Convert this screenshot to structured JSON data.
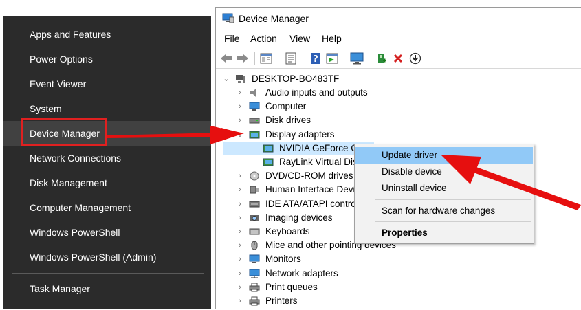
{
  "winx_menu": {
    "items": [
      {
        "label": "Apps and Features"
      },
      {
        "label": "Power Options"
      },
      {
        "label": "Event Viewer"
      },
      {
        "label": "System"
      },
      {
        "label": "Device Manager"
      },
      {
        "label": "Network Connections"
      },
      {
        "label": "Disk Management"
      },
      {
        "label": "Computer Management"
      },
      {
        "label": "Windows PowerShell"
      },
      {
        "label": "Windows PowerShell (Admin)"
      },
      {
        "label": "Task Manager"
      }
    ],
    "highlighted": "Device Manager"
  },
  "window": {
    "title": "Device Manager",
    "menu": [
      "File",
      "Action",
      "View",
      "Help"
    ],
    "toolbar_icons": [
      "back-arrow-icon",
      "forward-arrow-icon",
      "properties-icon",
      "help-doc-icon",
      "help-icon",
      "view-icon",
      "monitor-icon",
      "add-driver-icon",
      "uninstall-x-icon",
      "download-icon"
    ]
  },
  "tree": {
    "root": "DESKTOP-BO483TF",
    "categories": [
      {
        "label": "Audio inputs and outputs",
        "icon": "speaker-icon"
      },
      {
        "label": "Computer",
        "icon": "computer-icon"
      },
      {
        "label": "Disk drives",
        "icon": "disk-icon"
      },
      {
        "label": "Display adapters",
        "icon": "display-adapter-icon",
        "expanded": true,
        "children": [
          "NVIDIA GeForce GT",
          "RayLink Virtual Dis"
        ]
      },
      {
        "label": "DVD/CD-ROM drives",
        "icon": "dvd-icon"
      },
      {
        "label": "Human Interface Devic",
        "icon": "hid-icon"
      },
      {
        "label": "IDE ATA/ATAPI control",
        "icon": "ide-icon"
      },
      {
        "label": "Imaging devices",
        "icon": "camera-icon"
      },
      {
        "label": "Keyboards",
        "icon": "keyboard-icon"
      },
      {
        "label": "Mice and other pointing devices",
        "icon": "mouse-icon"
      },
      {
        "label": "Monitors",
        "icon": "monitor-icon"
      },
      {
        "label": "Network adapters",
        "icon": "network-icon"
      },
      {
        "label": "Print queues",
        "icon": "printer-icon"
      },
      {
        "label": "Printers",
        "icon": "printer-icon"
      }
    ]
  },
  "context_menu": {
    "items": [
      {
        "label": "Update driver",
        "highlighted": true
      },
      {
        "label": "Disable device"
      },
      {
        "label": "Uninstall device"
      },
      {
        "label": "Scan for hardware changes"
      },
      {
        "label": "Properties",
        "bold": true
      }
    ]
  },
  "colors": {
    "menu_bg": "#2b2b2b",
    "highlight_red": "#e02020",
    "context_hover": "#91c9f7"
  }
}
